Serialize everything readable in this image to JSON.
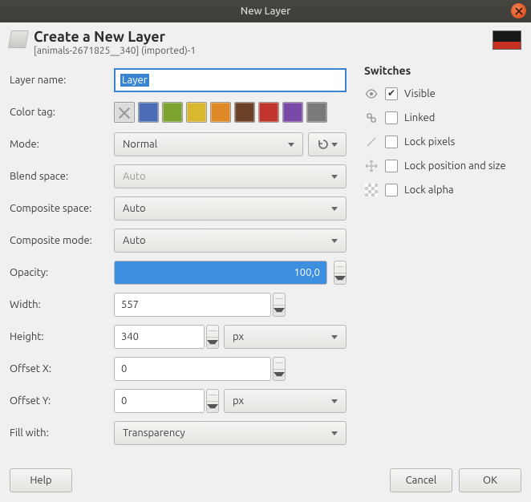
{
  "window": {
    "title": "New Layer"
  },
  "header": {
    "title": "Create a New Layer",
    "subtitle": "[animals-2671825__340] (imported)-1"
  },
  "form": {
    "layer_name_label": "Layer name:",
    "layer_name_value": "Layer",
    "color_tag_label": "Color tag:",
    "color_tags": [
      "none",
      "#4a6db5",
      "#7da32f",
      "#d8b82e",
      "#df8a26",
      "#6b4228",
      "#c1352f",
      "#7a4aa8",
      "#7a7a7a"
    ],
    "mode_label": "Mode:",
    "mode_value": "Normal",
    "blend_space_label": "Blend space:",
    "blend_space_value": "Auto",
    "composite_space_label": "Composite space:",
    "composite_space_value": "Auto",
    "composite_mode_label": "Composite mode:",
    "composite_mode_value": "Auto",
    "opacity_label": "Opacity:",
    "opacity_value": "100,0",
    "width_label": "Width:",
    "width_value": "557",
    "height_label": "Height:",
    "height_value": "340",
    "height_unit": "px",
    "offset_x_label": "Offset X:",
    "offset_x_value": "0",
    "offset_y_label": "Offset Y:",
    "offset_y_value": "0",
    "offset_unit": "px",
    "fill_with_label": "Fill with:",
    "fill_with_value": "Transparency"
  },
  "switches": {
    "title": "Switches",
    "visible": {
      "label": "Visible",
      "checked": true
    },
    "linked": {
      "label": "Linked",
      "checked": false
    },
    "lock_pixels": {
      "label": "Lock pixels",
      "checked": false
    },
    "lock_position": {
      "label": "Lock position and size",
      "checked": false
    },
    "lock_alpha": {
      "label": "Lock alpha",
      "checked": false
    }
  },
  "buttons": {
    "help": "Help",
    "cancel": "Cancel",
    "ok": "OK"
  }
}
